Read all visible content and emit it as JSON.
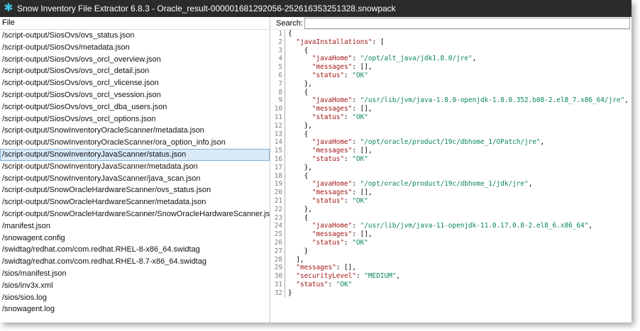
{
  "titlebar": {
    "title": "Snow Inventory File Extractor 6.8.3 - Oracle_result-000001681292056-252616353251328.snowpack",
    "icon": "snowflake-icon",
    "icon_color": "#3fc1e6"
  },
  "file_panel": {
    "header": "File",
    "selected_index": 11,
    "files": [
      "/script-output/SiosOvs/ovs_status.json",
      "/script-output/SiosOvs/metadata.json",
      "/script-output/SiosOvs/ovs_orcl_overview.json",
      "/script-output/SiosOvs/ovs_orcl_detail.json",
      "/script-output/SiosOvs/ovs_orcl_vlicense.json",
      "/script-output/SiosOvs/ovs_orcl_vsession.json",
      "/script-output/SiosOvs/ovs_orcl_dba_users.json",
      "/script-output/SiosOvs/ovs_orcl_options.json",
      "/script-output/SnowInventoryOracleScanner/metadata.json",
      "/script-output/SnowInventoryOracleScanner/ora_option_info.json",
      "/script-output/SnowInventoryJavaScanner/status.json",
      "/script-output/SnowInventoryJavaScanner/metadata.json",
      "/script-output/SnowInventoryJavaScanner/java_scan.json",
      "/script-output/SnowOracleHardwareScanner/ovs_status.json",
      "/script-output/SnowOracleHardwareScanner/metadata.json",
      "/script-output/SnowOracleHardwareScanner/SnowOracleHardwareScanner.json",
      "/manifest.json",
      "/snowagent.config",
      "/swidtag/redhat.com/com.redhat.RHEL-8-x86_64.swidtag",
      "/swidtag/redhat.com/com.redhat.RHEL-8.7-x86_64.swidtag",
      "/sios/manifest.json",
      "/sios/inv3x.xml",
      "/sios/sios.log",
      "/snowagent.log"
    ]
  },
  "search": {
    "label": "Search:",
    "value": ""
  },
  "code": {
    "lines": [
      "{",
      "  \"javaInstallations\": [",
      "    {",
      "      \"javaHome\": \"/opt/alt_java/jdk1.8.0/jre\",",
      "      \"messages\": [],",
      "      \"status\": \"OK\"",
      "    },",
      "    {",
      "      \"javaHome\": \"/usr/lib/jvm/java-1.8.0-openjdk-1.8.0.352.b08-2.el8_7.x86_64/jre\",",
      "      \"messages\": [],",
      "      \"status\": \"OK\"",
      "    },",
      "    {",
      "      \"javaHome\": \"/opt/oracle/product/19c/dbhome_1/OPatch/jre\",",
      "      \"messages\": [],",
      "      \"status\": \"OK\"",
      "    },",
      "    {",
      "      \"javaHome\": \"/opt/oracle/product/19c/dbhome_1/jdk/jre\",",
      "      \"messages\": [],",
      "      \"status\": \"OK\"",
      "    },",
      "    {",
      "      \"javaHome\": \"/usr/lib/jvm/java-11-openjdk-11.0.17.0.8-2.el8_6.x86_64\",",
      "      \"messages\": [],",
      "      \"status\": \"OK\"",
      "    }",
      "  ],",
      "  \"messages\": [],",
      "  \"securityLevel\": \"MEDIUM\",",
      "  \"status\": \"OK\"",
      "}"
    ]
  }
}
